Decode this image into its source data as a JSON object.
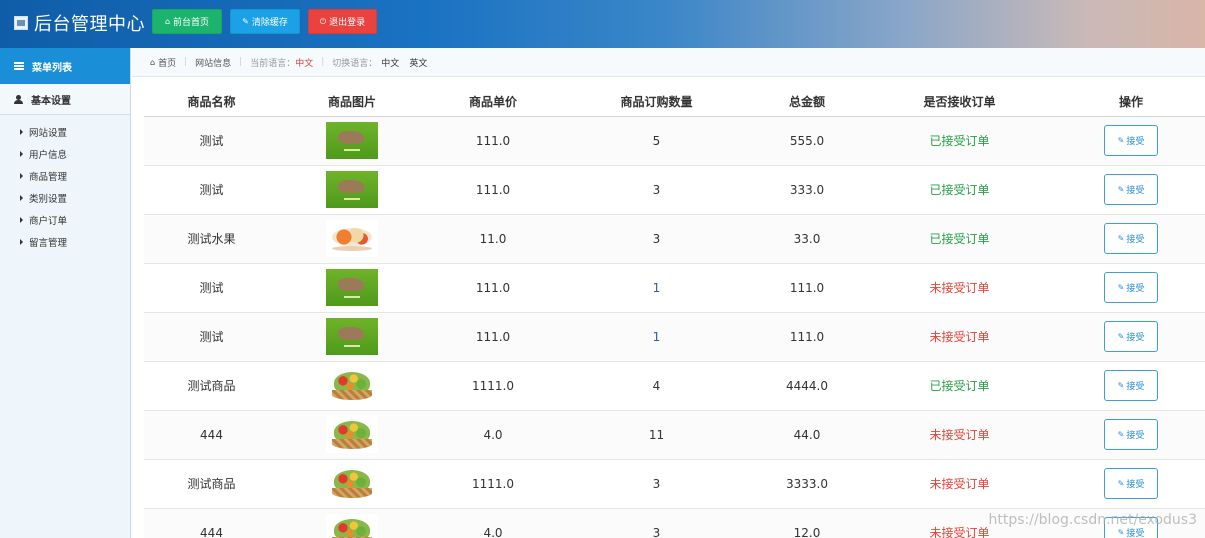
{
  "header": {
    "title": "后台管理中心",
    "buttons": {
      "home": "前台首页",
      "clear_cache": "清除缓存",
      "logout": "退出登录"
    },
    "colors": {
      "home": "#1cb36f",
      "clear_cache": "#1aa1e6",
      "logout": "#e9423f"
    }
  },
  "sidebar": {
    "header": "菜单列表",
    "group": "基本设置",
    "items": [
      "网站设置",
      "用户信息",
      "商品管理",
      "类别设置",
      "商户订单",
      "留言管理"
    ]
  },
  "breadcrumb": {
    "home": "首页",
    "site_info": "网站信息",
    "current_lang_label": "当前语言：",
    "current_lang": "中文",
    "switch_lang_label": "切换语言：",
    "lang_options": [
      "中文",
      "英文"
    ]
  },
  "table": {
    "columns": [
      "商品名称",
      "商品图片",
      "商品单价",
      "商品订购数量",
      "总金额",
      "是否接收订单",
      "操作"
    ],
    "action_label": "接受",
    "rows": [
      {
        "name": "测试",
        "image": "green-goods",
        "price": "111.0",
        "qty": "5",
        "total": "555.0",
        "status": "已接受订单",
        "accepted": true
      },
      {
        "name": "测试",
        "image": "green-goods",
        "price": "111.0",
        "qty": "3",
        "total": "333.0",
        "status": "已接受订单",
        "accepted": true
      },
      {
        "name": "测试水果",
        "image": "fruit-plate",
        "price": "11.0",
        "qty": "3",
        "total": "33.0",
        "status": "已接受订单",
        "accepted": true
      },
      {
        "name": "测试",
        "image": "green-goods",
        "price": "111.0",
        "qty": "1",
        "total": "111.0",
        "status": "未接受订单",
        "accepted": false
      },
      {
        "name": "测试",
        "image": "green-goods",
        "price": "111.0",
        "qty": "1",
        "total": "111.0",
        "status": "未接受订单",
        "accepted": false
      },
      {
        "name": "测试商品",
        "image": "fruit-basket",
        "price": "1111.0",
        "qty": "4",
        "total": "4444.0",
        "status": "已接受订单",
        "accepted": true
      },
      {
        "name": "444",
        "image": "fruit-basket",
        "price": "4.0",
        "qty": "11",
        "total": "44.0",
        "status": "未接受订单",
        "accepted": false
      },
      {
        "name": "测试商品",
        "image": "fruit-basket",
        "price": "1111.0",
        "qty": "3",
        "total": "3333.0",
        "status": "未接受订单",
        "accepted": false
      },
      {
        "name": "444",
        "image": "fruit-basket",
        "price": "4.0",
        "qty": "3",
        "total": "12.0",
        "status": "未接受订单",
        "accepted": false
      }
    ]
  },
  "watermark": "https://blog.csdn.net/exodus3",
  "colors": {
    "accepted": "#27a045",
    "not_accepted": "#e84237",
    "accent": "#1a8fd8"
  }
}
